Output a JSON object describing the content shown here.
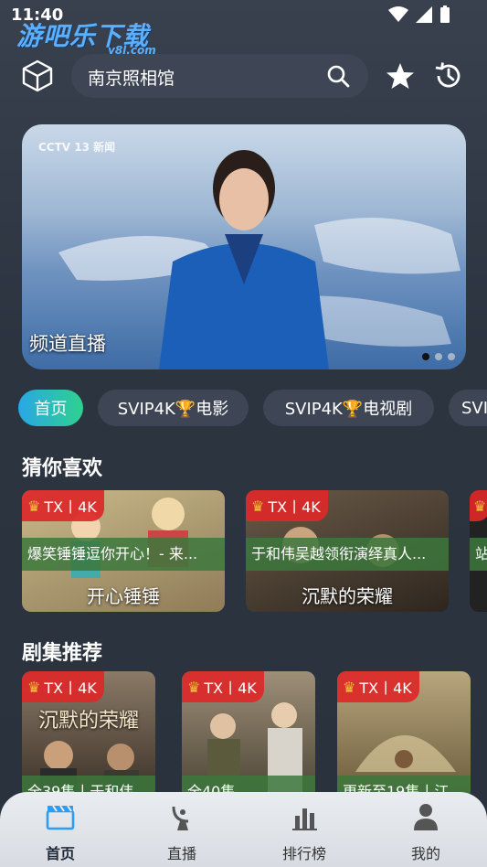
{
  "status": {
    "time": "11:40"
  },
  "watermark": {
    "brand": "游吧乐下载",
    "domain": "y8l.com"
  },
  "search": {
    "text": "南京照相馆"
  },
  "banner": {
    "caption": "频道直播",
    "logo": "CCTV 13 新闻"
  },
  "tabs": [
    "首页",
    "SVIP4K🏆电影",
    "SVIP4K🏆电视剧",
    "SVIP"
  ],
  "sections": [
    {
      "title": "猜你喜欢",
      "cards": [
        {
          "badge": "TX丨4K",
          "desc": "爆笑锤锤逗你开心！- 来...",
          "title": "开心锤锤"
        },
        {
          "badge": "TX丨4K",
          "desc": "于和伟吴越领衔演绎真人...",
          "title": "沉默的荣耀"
        },
        {
          "badge": "TX丨4K",
          "desc": "站",
          "title": ""
        }
      ]
    },
    {
      "title": "剧集推荐",
      "cards": [
        {
          "badge": "TX丨4K",
          "desc": "全39集丨于和伟",
          "title": "沉默的荣耀"
        },
        {
          "badge": "TX丨4K",
          "desc": "全40集",
          "title": ""
        },
        {
          "badge": "TX丨4K",
          "desc": "更新至19集丨江",
          "title": ""
        }
      ]
    }
  ],
  "nav": [
    {
      "label": "首页",
      "icon": "clapperboard-icon",
      "active": true
    },
    {
      "label": "直播",
      "icon": "satellite-dish-icon",
      "active": false
    },
    {
      "label": "排行榜",
      "icon": "bar-chart-icon",
      "active": false
    },
    {
      "label": "我的",
      "icon": "person-icon",
      "active": false
    }
  ],
  "colors": {
    "accent": "#2a9df4",
    "badge": "#dc2828",
    "tab_gradient_start": "#29a7e6",
    "tab_gradient_end": "#2fd18e"
  }
}
